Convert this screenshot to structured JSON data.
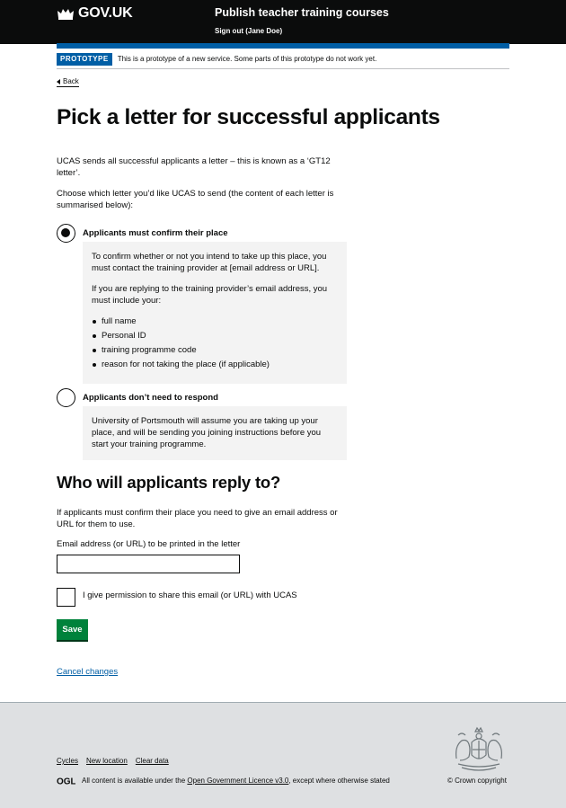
{
  "header": {
    "logo_text": "GOV.UK",
    "service_name": "Publish teacher training courses",
    "sign_out": "Sign out (Jane Doe)"
  },
  "phase_banner": {
    "tag": "PROTOTYPE",
    "text": "This is a prototype of a new service. Some parts of this prototype do not work yet."
  },
  "back_link": "Back",
  "page_title": "Pick a letter for successful applicants",
  "intro": {
    "paragraph_1": "UCAS sends all successful applicants a letter – this is known as a ‘GT12 letter’.",
    "paragraph_2": "Choose which letter you’d like UCAS to send (the content of each letter is summarised below):"
  },
  "options": [
    {
      "label": "Applicants must confirm their place",
      "selected": true,
      "panel": {
        "paragraph_1": "To confirm whether or not you intend to take up this place, you must contact the training provider at [email address or URL].",
        "paragraph_2": "If you are replying to the training provider’s email address, you must include your:",
        "list": [
          "full name",
          "Personal ID",
          "training programme code",
          "reason for not taking the place (if applicable)"
        ]
      }
    },
    {
      "label": "Applicants don’t need to respond",
      "selected": false,
      "panel": {
        "paragraph_1": "University of Portsmouth will assume you are taking up your place, and will be sending you joining instructions before you start your training programme."
      }
    }
  ],
  "reply_section": {
    "heading": "Who will applicants reply to?",
    "description": "If applicants must confirm their place you need to give an email address or URL for them to use.",
    "email_label": "Email address (or URL) to be printed in the letter",
    "email_value": "",
    "permission_label": "I give permission to share this email (or URL) with UCAS",
    "permission_checked": false
  },
  "save_button": "Save",
  "cancel_link": "Cancel changes",
  "footer": {
    "links": [
      "Cycles",
      "New location",
      "Clear data"
    ],
    "licence_prefix": "All content is available under the ",
    "licence_link": "Open Government Licence v3.0",
    "licence_suffix": ", except where otherwise stated",
    "ogl_logo": "OGL",
    "copyright": "© Crown copyright"
  },
  "colors": {
    "header_bg": "#0b0c0c",
    "brand_blue": "#005ea5",
    "button_green": "#00823b",
    "footer_bg": "#dee0e2",
    "link": "#005ea5"
  }
}
